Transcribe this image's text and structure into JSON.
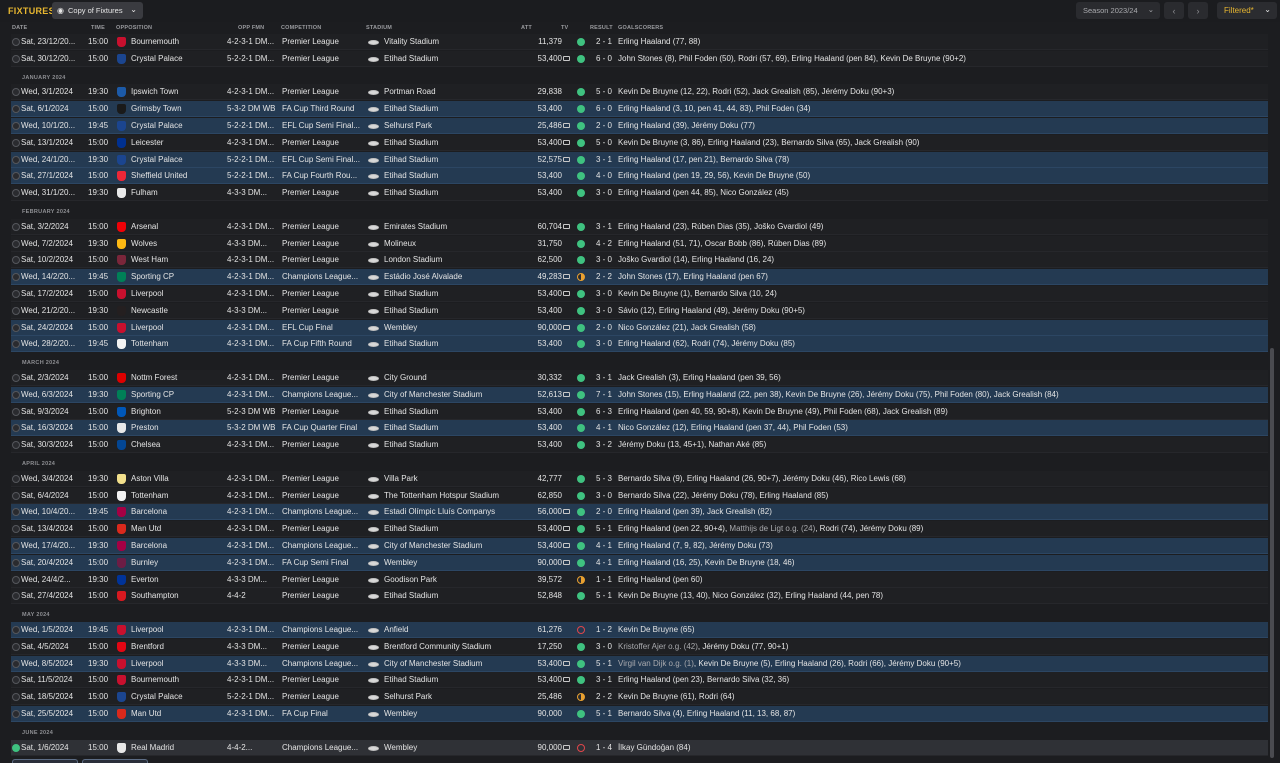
{
  "header": {
    "title": "FIXTURES",
    "view_select": "Copy of Fixtures",
    "season": "Season 2023/24",
    "filter": "Filtered*"
  },
  "columns": [
    "DATE",
    "TIME",
    "OPPOSITION",
    "OPP FMN",
    "COMPETITION",
    "STADIUM",
    "ATT",
    "TV",
    "RESULT",
    "GOALSCORERS"
  ],
  "colors": {
    "win": "#3fc280",
    "draw": "#e8a030",
    "loss": "#e0464b",
    "accent": "#e8b730",
    "highlight": "#243a52"
  },
  "items": [
    {
      "kind": "row",
      "date": "Sat, 23/12/20...",
      "time": "15:00",
      "opp": "Bournemouth",
      "crest": "#c8102e",
      "fmn": "4-2-3-1 DM...",
      "comp": "Premier League",
      "stadium": "Vitality Stadium",
      "att": "11,379",
      "tv": false,
      "result": "w",
      "score": "2 - 1",
      "goals": "Erling Haaland (77, 88)"
    },
    {
      "kind": "row",
      "date": "Sat, 30/12/20...",
      "time": "15:00",
      "opp": "Crystal Palace",
      "crest": "#1b458f",
      "fmn": "5-2-2-1 DM...",
      "comp": "Premier League",
      "stadium": "Etihad Stadium",
      "att": "53,400",
      "tv": true,
      "result": "w",
      "score": "6 - 0",
      "goals": "John Stones (8), Phil Foden (50), Rodri (57, 69), Erling Haaland (pen 84), Kevin De Bruyne (90+2)"
    },
    {
      "kind": "month",
      "label": "JANUARY 2024"
    },
    {
      "kind": "row",
      "date": "Wed, 3/1/2024",
      "time": "19:30",
      "opp": "Ipswich Town",
      "crest": "#1c5aa8",
      "fmn": "4-2-3-1 DM...",
      "comp": "Premier League",
      "stadium": "Portman Road",
      "att": "29,838",
      "tv": false,
      "result": "w",
      "score": "5 - 0",
      "goals": "Kevin De Bruyne (12, 22), Rodri (52), Jack Grealish (85), Jérémy Doku (90+3)"
    },
    {
      "kind": "row",
      "hl": true,
      "date": "Sat, 6/1/2024",
      "time": "15:00",
      "opp": "Grimsby Town",
      "crest": "#1a1a1a",
      "fmn": "5-3-2 DM WB",
      "comp": "FA Cup Third Round",
      "stadium": "Etihad Stadium",
      "att": "53,400",
      "tv": false,
      "result": "w",
      "score": "6 - 0",
      "goals": "Erling Haaland (3, 10, pen 41, 44, 83), Phil Foden (34)"
    },
    {
      "kind": "row",
      "hl": true,
      "date": "Wed, 10/1/20...",
      "time": "19:45",
      "opp": "Crystal Palace",
      "crest": "#1b458f",
      "fmn": "5-2-2-1 DM...",
      "comp": "EFL Cup Semi Final...",
      "stadium": "Selhurst Park",
      "att": "25,486",
      "tv": true,
      "result": "w",
      "score": "2 - 0",
      "goals": "Erling Haaland (39), Jérémy Doku (77)"
    },
    {
      "kind": "row",
      "date": "Sat, 13/1/2024",
      "time": "15:00",
      "opp": "Leicester",
      "crest": "#003090",
      "fmn": "4-2-3-1 DM...",
      "comp": "Premier League",
      "stadium": "Etihad Stadium",
      "att": "53,400",
      "tv": true,
      "result": "w",
      "score": "5 - 0",
      "goals": "Kevin De Bruyne (3, 86), Erling Haaland (23), Bernardo Silva (65), Jack Grealish (90)"
    },
    {
      "kind": "row",
      "hl": true,
      "date": "Wed, 24/1/20...",
      "time": "19:30",
      "opp": "Crystal Palace",
      "crest": "#1b458f",
      "fmn": "5-2-2-1 DM...",
      "comp": "EFL Cup Semi Final...",
      "stadium": "Etihad Stadium",
      "att": "52,575",
      "tv": true,
      "result": "w",
      "score": "3 - 1",
      "goals": "Erling Haaland (17, pen 21), Bernardo Silva (78)"
    },
    {
      "kind": "row",
      "hl": true,
      "date": "Sat, 27/1/2024",
      "time": "15:00",
      "opp": "Sheffield United",
      "crest": "#ee2737",
      "fmn": "5-2-2-1 DM...",
      "comp": "FA Cup Fourth Rou...",
      "stadium": "Etihad Stadium",
      "att": "53,400",
      "tv": false,
      "result": "w",
      "score": "4 - 0",
      "goals": "Erling Haaland (pen 19, 29, 56), Kevin De Bruyne (50)"
    },
    {
      "kind": "row",
      "date": "Wed, 31/1/20...",
      "time": "19:30",
      "opp": "Fulham",
      "crest": "#e8e8e8",
      "fmn": "4-3-3 DM...",
      "comp": "Premier League",
      "stadium": "Etihad Stadium",
      "att": "53,400",
      "tv": false,
      "result": "w",
      "score": "3 - 0",
      "goals": "Erling Haaland (pen 44, 85), Nico González (45)"
    },
    {
      "kind": "month",
      "label": "FEBRUARY 2024"
    },
    {
      "kind": "row",
      "date": "Sat, 3/2/2024",
      "time": "15:00",
      "opp": "Arsenal",
      "crest": "#ef0107",
      "fmn": "4-2-3-1 DM...",
      "comp": "Premier League",
      "stadium": "Emirates Stadium",
      "att": "60,704",
      "tv": true,
      "result": "w",
      "score": "3 - 1",
      "goals": "Erling Haaland (23), Rúben Dias (35), Joško Gvardiol (49)"
    },
    {
      "kind": "row",
      "date": "Wed, 7/2/2024",
      "time": "19:30",
      "opp": "Wolves",
      "crest": "#fdb913",
      "fmn": "4-3-3 DM...",
      "comp": "Premier League",
      "stadium": "Molineux",
      "att": "31,750",
      "tv": false,
      "result": "w",
      "score": "4 - 2",
      "goals": "Erling Haaland (51, 71), Oscar Bobb (86), Rúben Dias (89)"
    },
    {
      "kind": "row",
      "date": "Sat, 10/2/2024",
      "time": "15:00",
      "opp": "West Ham",
      "crest": "#7a263a",
      "fmn": "4-2-3-1 DM...",
      "comp": "Premier League",
      "stadium": "London Stadium",
      "att": "62,500",
      "tv": false,
      "result": "w",
      "score": "3 - 0",
      "goals": "Joško Gvardiol (14), Erling Haaland (16, 24)"
    },
    {
      "kind": "row",
      "hl": true,
      "date": "Wed, 14/2/20...",
      "time": "19:45",
      "opp": "Sporting CP",
      "crest": "#008057",
      "fmn": "4-2-3-1 DM...",
      "comp": "Champions League...",
      "stadium": "Estádio José Alvalade",
      "att": "49,283",
      "tv": true,
      "result": "d",
      "score": "2 - 2",
      "goals": "John Stones (17), Erling Haaland (pen 67)"
    },
    {
      "kind": "row",
      "date": "Sat, 17/2/2024",
      "time": "15:00",
      "opp": "Liverpool",
      "crest": "#c8102e",
      "fmn": "4-2-3-1 DM...",
      "comp": "Premier League",
      "stadium": "Etihad Stadium",
      "att": "53,400",
      "tv": true,
      "result": "w",
      "score": "3 - 0",
      "goals": "Kevin De Bruyne (1), Bernardo Silva (10, 24)"
    },
    {
      "kind": "row",
      "date": "Wed, 21/2/20...",
      "time": "19:30",
      "opp": "Newcastle",
      "crest": "#241f20",
      "fmn": "4-3-3 DM...",
      "comp": "Premier League",
      "stadium": "Etihad Stadium",
      "att": "53,400",
      "tv": false,
      "result": "w",
      "score": "3 - 0",
      "goals": "Sávio (12), Erling Haaland (49), Jérémy Doku (90+5)"
    },
    {
      "kind": "row",
      "hl": true,
      "date": "Sat, 24/2/2024",
      "time": "15:00",
      "opp": "Liverpool",
      "crest": "#c8102e",
      "fmn": "4-2-3-1 DM...",
      "comp": "EFL Cup Final",
      "stadium": "Wembley",
      "att": "90,000",
      "tv": true,
      "result": "w",
      "score": "2 - 0",
      "goals": "Nico González (21), Jack Grealish (58)"
    },
    {
      "kind": "row",
      "hl": true,
      "date": "Wed, 28/2/20...",
      "time": "19:45",
      "opp": "Tottenham",
      "crest": "#f2f2f2",
      "fmn": "4-2-3-1 DM...",
      "comp": "FA Cup Fifth Round",
      "stadium": "Etihad Stadium",
      "att": "53,400",
      "tv": false,
      "result": "w",
      "score": "3 - 0",
      "goals": "Erling Haaland (62), Rodri (74), Jérémy Doku (85)"
    },
    {
      "kind": "month",
      "label": "MARCH 2024"
    },
    {
      "kind": "row",
      "date": "Sat, 2/3/2024",
      "time": "15:00",
      "opp": "Nottm Forest",
      "crest": "#dd0000",
      "fmn": "4-2-3-1 DM...",
      "comp": "Premier League",
      "stadium": "City Ground",
      "att": "30,332",
      "tv": false,
      "result": "w",
      "score": "3 - 1",
      "goals": "Jack Grealish (3), Erling Haaland (pen 39, 56)"
    },
    {
      "kind": "row",
      "hl": true,
      "date": "Wed, 6/3/2024",
      "time": "19:30",
      "opp": "Sporting CP",
      "crest": "#008057",
      "fmn": "4-2-3-1 DM...",
      "comp": "Champions League...",
      "stadium": "City of Manchester Stadium",
      "att": "52,613",
      "tv": true,
      "result": "w",
      "score": "7 - 1",
      "goals": "John Stones (15), Erling Haaland (22, pen 38), Kevin De Bruyne (26), Jérémy Doku (75), Phil Foden (80), Jack Grealish (84)"
    },
    {
      "kind": "row",
      "date": "Sat, 9/3/2024",
      "time": "15:00",
      "opp": "Brighton",
      "crest": "#0057b8",
      "fmn": "5-2-3 DM WB",
      "comp": "Premier League",
      "stadium": "Etihad Stadium",
      "att": "53,400",
      "tv": false,
      "result": "w",
      "score": "6 - 3",
      "goals": "Erling Haaland (pen 40, 59, 90+8), Kevin De Bruyne (49), Phil Foden (68), Jack Grealish (89)"
    },
    {
      "kind": "row",
      "hl": true,
      "date": "Sat, 16/3/2024",
      "time": "15:00",
      "opp": "Preston",
      "crest": "#e8e8e8",
      "fmn": "5-3-2 DM WB",
      "comp": "FA Cup Quarter Final",
      "stadium": "Etihad Stadium",
      "att": "53,400",
      "tv": false,
      "result": "w",
      "score": "4 - 1",
      "goals": "Nico González (12), Erling Haaland (pen 37, 44), Phil Foden (53)"
    },
    {
      "kind": "row",
      "date": "Sat, 30/3/2024",
      "time": "15:00",
      "opp": "Chelsea",
      "crest": "#034694",
      "fmn": "4-2-3-1 DM...",
      "comp": "Premier League",
      "stadium": "Etihad Stadium",
      "att": "53,400",
      "tv": false,
      "result": "w",
      "score": "3 - 2",
      "goals": "Jérémy Doku (13, 45+1), Nathan Aké (85)"
    },
    {
      "kind": "month",
      "label": "APRIL 2024"
    },
    {
      "kind": "row",
      "date": "Wed, 3/4/2024",
      "time": "19:30",
      "opp": "Aston Villa",
      "crest": "#f2e08c",
      "fmn": "4-2-3-1 DM...",
      "comp": "Premier League",
      "stadium": "Villa Park",
      "att": "42,777",
      "tv": false,
      "result": "w",
      "score": "5 - 3",
      "goals": "Bernardo Silva (9), Erling Haaland (26, 90+7), Jérémy Doku (46), Rico Lewis (68)"
    },
    {
      "kind": "row",
      "date": "Sat, 6/4/2024",
      "time": "15:00",
      "opp": "Tottenham",
      "crest": "#f2f2f2",
      "fmn": "4-2-3-1 DM...",
      "comp": "Premier League",
      "stadium": "The Tottenham Hotspur Stadium",
      "att": "62,850",
      "tv": false,
      "result": "w",
      "score": "3 - 0",
      "goals": "Bernardo Silva (22), Jérémy Doku (78), Erling Haaland (85)"
    },
    {
      "kind": "row",
      "hl": true,
      "date": "Wed, 10/4/20...",
      "time": "19:45",
      "opp": "Barcelona",
      "crest": "#a50044",
      "fmn": "4-2-3-1 DM...",
      "comp": "Champions League...",
      "stadium": "Estadi Olímpic Lluís Companys",
      "att": "56,000",
      "tv": true,
      "result": "w",
      "score": "2 - 0",
      "goals": "Erling Haaland (pen 39), Jack Grealish (82)"
    },
    {
      "kind": "row",
      "date": "Sat, 13/4/2024",
      "time": "15:00",
      "opp": "Man Utd",
      "crest": "#da291c",
      "fmn": "4-2-3-1 DM...",
      "comp": "Premier League",
      "stadium": "Etihad Stadium",
      "att": "53,400",
      "tv": true,
      "result": "w",
      "score": "5 - 1",
      "goals_parts": [
        {
          "t": "Erling Haaland (pen 22, 90+4), "
        },
        {
          "t": "Matthijs de Ligt o.g. (24)",
          "og": true
        },
        {
          "t": ", Rodri (74), Jérémy Doku (89)"
        }
      ]
    },
    {
      "kind": "row",
      "hl": true,
      "date": "Wed, 17/4/20...",
      "time": "19:30",
      "opp": "Barcelona",
      "crest": "#a50044",
      "fmn": "4-2-3-1 DM...",
      "comp": "Champions League...",
      "stadium": "City of Manchester Stadium",
      "att": "53,400",
      "tv": true,
      "result": "w",
      "score": "4 - 1",
      "goals": "Erling Haaland (7, 9, 82), Jérémy Doku (73)"
    },
    {
      "kind": "row",
      "hl": true,
      "date": "Sat, 20/4/2024",
      "time": "15:00",
      "opp": "Burnley",
      "crest": "#6c1d45",
      "fmn": "4-2-3-1 DM...",
      "comp": "FA Cup Semi Final",
      "stadium": "Wembley",
      "att": "90,000",
      "tv": true,
      "result": "w",
      "score": "4 - 1",
      "goals": "Erling Haaland (16, 25), Kevin De Bruyne (18, 46)"
    },
    {
      "kind": "row",
      "date": "Wed, 24/4/2...",
      "time": "19:30",
      "opp": "Everton",
      "crest": "#003399",
      "fmn": "4-3-3 DM...",
      "comp": "Premier League",
      "stadium": "Goodison Park",
      "att": "39,572",
      "tv": false,
      "result": "d",
      "score": "1 - 1",
      "goals": "Erling Haaland (pen 60)"
    },
    {
      "kind": "row",
      "date": "Sat, 27/4/2024",
      "time": "15:00",
      "opp": "Southampton",
      "crest": "#d71920",
      "fmn": "4-4-2",
      "comp": "Premier League",
      "stadium": "Etihad Stadium",
      "att": "52,848",
      "tv": false,
      "result": "w",
      "score": "5 - 1",
      "goals": "Kevin De Bruyne (13, 40), Nico González (32), Erling Haaland (44, pen 78)"
    },
    {
      "kind": "month",
      "label": "MAY 2024"
    },
    {
      "kind": "row",
      "hl": true,
      "date": "Wed, 1/5/2024",
      "time": "19:45",
      "opp": "Liverpool",
      "crest": "#c8102e",
      "fmn": "4-2-3-1 DM...",
      "comp": "Champions League...",
      "stadium": "Anfield",
      "att": "61,276",
      "tv": false,
      "result": "l",
      "score": "1 - 2",
      "goals": "Kevin De Bruyne (65)"
    },
    {
      "kind": "row",
      "date": "Sat, 4/5/2024",
      "time": "15:00",
      "opp": "Brentford",
      "crest": "#e30613",
      "fmn": "4-3-3 DM...",
      "comp": "Premier League",
      "stadium": "Brentford Community Stadium",
      "att": "17,250",
      "tv": false,
      "result": "w",
      "score": "3 - 0",
      "goals_parts": [
        {
          "t": "Kristoffer Ajer o.g. (42)",
          "og": true
        },
        {
          "t": ", Jérémy Doku (77, 90+1)"
        }
      ]
    },
    {
      "kind": "row",
      "hl": true,
      "date": "Wed, 8/5/2024",
      "time": "19:30",
      "opp": "Liverpool",
      "crest": "#c8102e",
      "fmn": "4-3-3 DM...",
      "comp": "Champions League...",
      "stadium": "City of Manchester Stadium",
      "att": "53,400",
      "tv": true,
      "result": "w",
      "score": "5 - 1",
      "goals_parts": [
        {
          "t": "Virgil van Dijk o.g. (1)",
          "og": true
        },
        {
          "t": ", Kevin De Bruyne (5), Erling Haaland (26), Rodri (66), Jérémy Doku (90+5)"
        }
      ]
    },
    {
      "kind": "row",
      "date": "Sat, 11/5/2024",
      "time": "15:00",
      "opp": "Bournemouth",
      "crest": "#c8102e",
      "fmn": "4-2-3-1 DM...",
      "comp": "Premier League",
      "stadium": "Etihad Stadium",
      "att": "53,400",
      "tv": true,
      "result": "w",
      "score": "3 - 1",
      "goals": "Erling Haaland (pen 23), Bernardo Silva (32, 36)"
    },
    {
      "kind": "row",
      "date": "Sat, 18/5/2024",
      "time": "15:00",
      "opp": "Crystal Palace",
      "crest": "#1b458f",
      "fmn": "5-2-2-1 DM...",
      "comp": "Premier League",
      "stadium": "Selhurst Park",
      "att": "25,486",
      "tv": false,
      "result": "d",
      "score": "2 - 2",
      "goals": "Kevin De Bruyne (61), Rodri (64)"
    },
    {
      "kind": "row",
      "hl": true,
      "date": "Sat, 25/5/2024",
      "time": "15:00",
      "opp": "Man Utd",
      "crest": "#da291c",
      "fmn": "4-2-3-1 DM...",
      "comp": "FA Cup Final",
      "stadium": "Wembley",
      "att": "90,000",
      "tv": false,
      "result": "w",
      "score": "5 - 1",
      "goals": "Bernardo Silva (4), Erling Haaland (11, 13, 68, 87)"
    },
    {
      "kind": "month",
      "label": "JUNE 2024"
    },
    {
      "kind": "row",
      "sel": true,
      "checked": true,
      "date": "Sat, 1/6/2024",
      "time": "15:00",
      "opp": "Real Madrid",
      "crest": "#e8e8e8",
      "fmn": "4-4-2...",
      "comp": "Champions League...",
      "stadium": "Wembley",
      "att": "90,000",
      "tv": true,
      "result": "l",
      "score": "1 - 4",
      "goals": "İlkay Gündoğan (84)"
    }
  ]
}
